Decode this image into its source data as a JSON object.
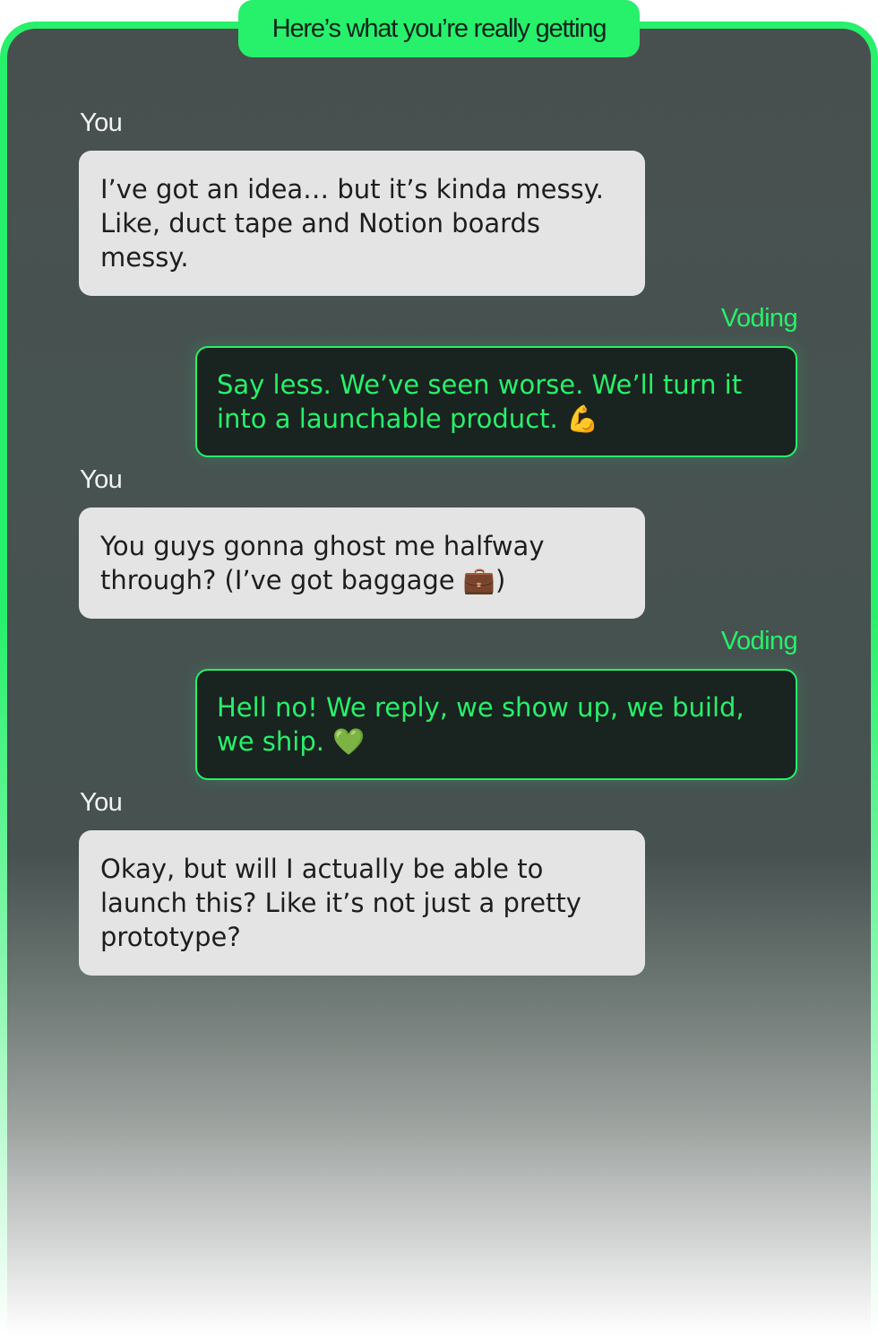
{
  "header": {
    "title": "Here’s what you’re really getting"
  },
  "messages": [
    {
      "sender": "You",
      "role": "user",
      "text": "I’ve got an idea… but it’s kinda messy. Like, duct tape and Notion boards messy."
    },
    {
      "sender": "Voding",
      "role": "bot",
      "text": "Say less. We’ve seen worse. We’ll turn it into a launchable product.",
      "emoji": "💪"
    },
    {
      "sender": "You",
      "role": "user",
      "text": "You guys gonna ghost me halfway through? (I’ve got baggage",
      "emoji": "💼",
      "suffix": ")"
    },
    {
      "sender": "Voding",
      "role": "bot",
      "text": "Hell no! We reply, we show up, we build, we ship.",
      "emoji": "💚"
    },
    {
      "sender": "You",
      "role": "user",
      "text": "Okay, but will I actually be able to launch this? Like it’s not just a pretty prototype?"
    }
  ],
  "colors": {
    "accent": "#27f06b",
    "user_bubble": "#e4e4e4",
    "bot_bubble": "#19231f",
    "panel": "#48504f"
  }
}
